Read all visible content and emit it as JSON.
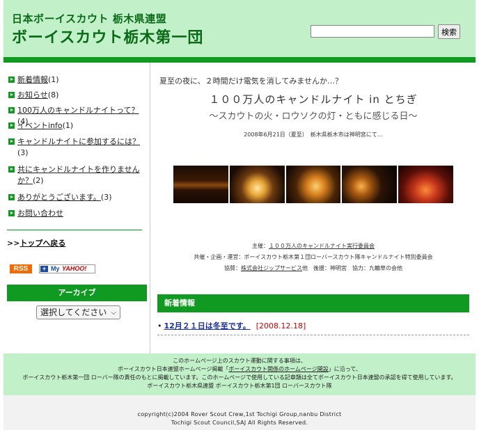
{
  "header": {
    "subtitle": "日本ボーイスカウト 栃木県連盟",
    "title": "ボーイスカウト栃木第一団",
    "search_placeholder": "",
    "search_button": "検索"
  },
  "sidebar": {
    "items": [
      {
        "label": "新着情報",
        "count": "(1)"
      },
      {
        "label": "お知らせ",
        "count": "(8)"
      },
      {
        "label": "100万人のキャンドルナイトって？",
        "count": "(4)"
      },
      {
        "label": "イベントinfo",
        "count": "(1)"
      },
      {
        "label": "キャンドルナイトに参加するには？",
        "count": "(3)"
      },
      {
        "label": "共にキャンドルナイトを作りませんか？",
        "count": "(2)"
      },
      {
        "label": "ありがとうございます。",
        "count": "(3)"
      },
      {
        "label": "お問い合わせ",
        "count": ""
      }
    ],
    "back_prefix": ">>",
    "back_label": "トップへ戻る",
    "rss_label": "RSS",
    "myyahoo_plus": "+",
    "myyahoo_my": "My",
    "myyahoo_yahoo": "YAHOO!",
    "archive_header": "アーカイブ",
    "archive_select": "選択してください"
  },
  "main": {
    "lead": "夏至の夜に、２時間だけ電気を消してみませんか…？",
    "headline": "１００万人のキャンドルナイト in とちぎ",
    "subhead": "～スカウトの火・ロウソクの灯・ともに感じる日～",
    "dateline": "2008年6月21日（夏至）　栃木県栃木市は神明宮にて…",
    "organizer_label": "主催：",
    "organizer": "１００万人のキャンドルナイト実行委員会",
    "cosponsor": "共催・企画・運営：ボーイスカウト栃木第１団ローバースカウト隊キャンドルナイト特別委員会",
    "support_label": "協賛：",
    "support": "株式会社ジップサービス",
    "support_suffix": "他　後援：神明宮　協力：九輪草の会他",
    "news_header": "新着情報",
    "news_items": [
      {
        "title": "12月２１日は冬至です。",
        "date": "[2008.12.18]"
      }
    ]
  },
  "footer": {
    "line1": "このホームページ上のスカウト運動に関する事項は、",
    "line2_pre": "ボーイスカウト日本連盟ホームページ掲載「",
    "line2_link": "ボーイスカウト関係のホームページ開設",
    "line2_post": "」に沿って、",
    "line3": "ボーイスカウト栃木第一団 ローバー隊の責任のもとに掲載しています。このホームページで使用している記章類は全てボーイスカウト日本連盟の承認を得て使用しています。",
    "line4": "ボーイスカウト栃木県連盟 ボーイスカウト栃木第1団 ローバースカウト隊",
    "copy1": "copyright(c)2004 Rover Scout Crew,1st Tochigi Group,nanbu District",
    "copy2": "Tochigi Scout Council,SAJ All Rights Reserved."
  }
}
